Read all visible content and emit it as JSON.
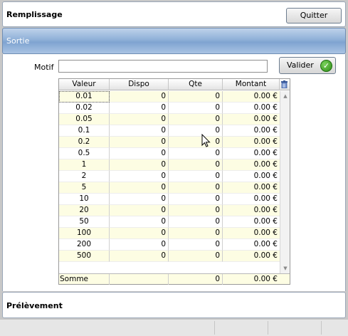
{
  "panels": {
    "remplissage": "Remplissage",
    "sortie": "Sortie",
    "prelevement": "Prélèvement"
  },
  "toolbar": {
    "quit_label": "Quitter"
  },
  "form": {
    "motif_label": "Motif",
    "motif_value": "",
    "valider_label": "Valider"
  },
  "grid": {
    "columns": [
      "Valeur",
      "Dispo",
      "Qte",
      "Montant"
    ],
    "rows": [
      [
        "0.01",
        "0",
        "0",
        "0.00 €"
      ],
      [
        "0.02",
        "0",
        "0",
        "0.00 €"
      ],
      [
        "0.05",
        "0",
        "0",
        "0.00 €"
      ],
      [
        "0.1",
        "0",
        "0",
        "0.00 €"
      ],
      [
        "0.2",
        "0",
        "0",
        "0.00 €"
      ],
      [
        "0.5",
        "0",
        "0",
        "0.00 €"
      ],
      [
        "1",
        "0",
        "0",
        "0.00 €"
      ],
      [
        "2",
        "0",
        "0",
        "0.00 €"
      ],
      [
        "5",
        "0",
        "0",
        "0.00 €"
      ],
      [
        "10",
        "0",
        "0",
        "0.00 €"
      ],
      [
        "20",
        "0",
        "0",
        "0.00 €"
      ],
      [
        "50",
        "0",
        "0",
        "0.00 €"
      ],
      [
        "100",
        "0",
        "0",
        "0.00 €"
      ],
      [
        "200",
        "0",
        "0",
        "0.00 €"
      ],
      [
        "500",
        "0",
        "0",
        "0.00 €"
      ]
    ],
    "footer": [
      "Somme",
      "",
      "0",
      "0.00 €"
    ]
  },
  "icons": {
    "valider": "check-icon",
    "grid_action": "trash-icon",
    "scroll_up": "scroll-up-arrow-icon",
    "scroll_down": "scroll-down-arrow-icon",
    "pointer": "mouse-cursor-icon"
  },
  "colors": {
    "selected_panel_header": "#8fb0d8",
    "row_alt": "#fdfde3",
    "check_green": "#2e8a17"
  }
}
